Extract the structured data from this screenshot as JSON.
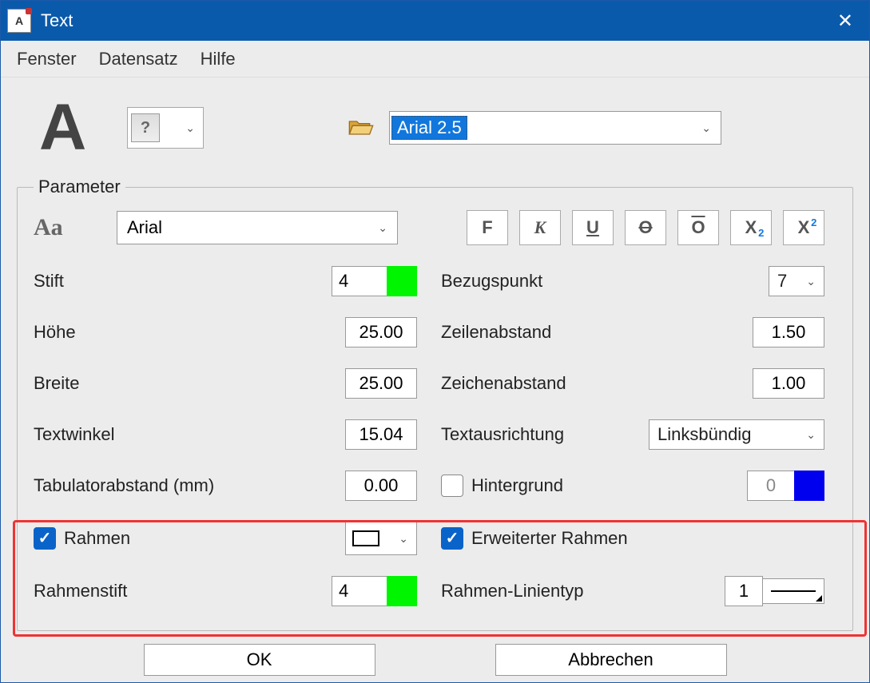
{
  "title": "Text",
  "menu": {
    "fenster": "Fenster",
    "datensatz": "Datensatz",
    "hilfe": "Hilfe"
  },
  "preset": {
    "value": "Arial 2.5"
  },
  "legend": "Parameter",
  "font": {
    "name": "Arial"
  },
  "labels": {
    "stift": "Stift",
    "hoehe": "Höhe",
    "breite": "Breite",
    "textwinkel": "Textwinkel",
    "tab": "Tabulatorabstand (mm)",
    "rahmen": "Rahmen",
    "rahmenstift": "Rahmenstift",
    "bezugspunkt": "Bezugspunkt",
    "zeilenabstand": "Zeilenabstand",
    "zeichenabstand": "Zeichenabstand",
    "textausrichtung": "Textausrichtung",
    "hintergrund": "Hintergrund",
    "erw_rahmen": "Erweiterter Rahmen",
    "rahmen_linientyp": "Rahmen-Linientyp"
  },
  "values": {
    "stift": "4",
    "hoehe": "25.00",
    "breite": "25.00",
    "textwinkel": "15.04",
    "tab": "0.00",
    "rahmenstift": "4",
    "bezugspunkt": "7",
    "zeilenabstand": "1.50",
    "zeichenabstand": "1.00",
    "textausrichtung": "Linksbündig",
    "hintergrund": "0",
    "rahmen_linientyp": "1"
  },
  "buttons": {
    "ok": "OK",
    "cancel": "Abbrechen"
  },
  "style_icons": {
    "bold": "F",
    "italic": "K",
    "underline": "U",
    "strike": "O",
    "overline": "O",
    "sub": "X",
    "sup": "X"
  },
  "sub_digit": "2",
  "sup_digit": "2",
  "colors": {
    "pen": "#00f500",
    "bg": "#0000ef"
  }
}
